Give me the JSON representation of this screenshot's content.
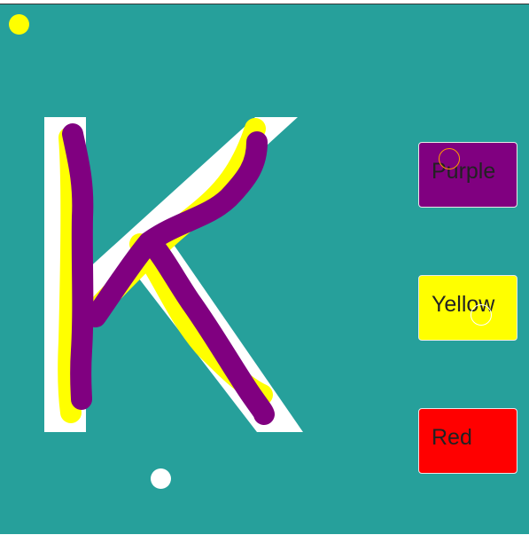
{
  "colors": {
    "background": "#26a09b",
    "letter_template": "#ffffff",
    "stroke_yellow": "#ffff00",
    "stroke_purple": "#800080",
    "indicator_yellow": "#ffff00",
    "indicator_white": "#ffffff"
  },
  "letter": "K",
  "buttons": [
    {
      "id": "purple",
      "label": "Purple",
      "color": "#800080"
    },
    {
      "id": "yellow",
      "label": "Yellow",
      "color": "#ffff00"
    },
    {
      "id": "red",
      "label": "Red",
      "color": "#ff0000"
    }
  ],
  "icons": {
    "current_color_dot": "yellow-dot-icon",
    "brush_cursor": "white-dot-icon"
  }
}
